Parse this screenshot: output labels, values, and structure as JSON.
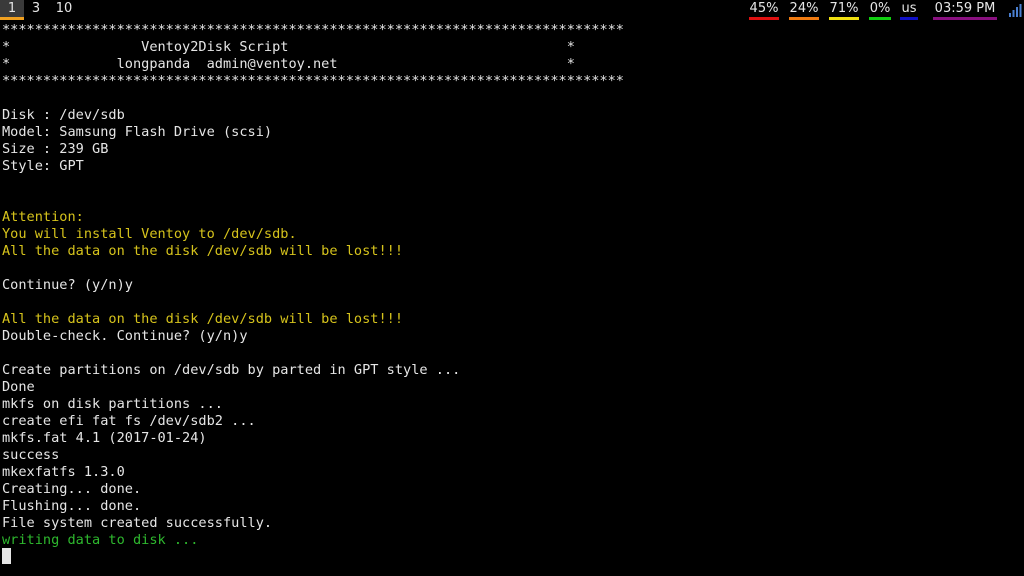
{
  "topbar": {
    "workspaces": [
      {
        "label": "1",
        "active": true
      },
      {
        "label": "3",
        "active": false
      },
      {
        "label": "10",
        "active": false
      }
    ],
    "stats": [
      {
        "label": "45%",
        "color": "#e01010"
      },
      {
        "label": "24%",
        "color": "#f07a10"
      },
      {
        "label": "71%",
        "color": "#f0e010"
      },
      {
        "label": "0%",
        "color": "#10d010"
      },
      {
        "label": "us",
        "color": "#1010c8"
      },
      {
        "label": "03:59 PM",
        "color": "#8a1080"
      }
    ],
    "signal_icon": "signal-bars-icon"
  },
  "terminal": {
    "lines": [
      {
        "text": "****************************************************************************",
        "color": "default"
      },
      {
        "text": "*                Ventoy2Disk Script                                  *",
        "color": "default"
      },
      {
        "text": "*             longpanda  admin@ventoy.net                            *",
        "color": "default"
      },
      {
        "text": "****************************************************************************",
        "color": "default"
      },
      {
        "text": "",
        "color": "default"
      },
      {
        "text": "Disk : /dev/sdb",
        "color": "default"
      },
      {
        "text": "Model: Samsung Flash Drive (scsi)",
        "color": "default"
      },
      {
        "text": "Size : 239 GB",
        "color": "default"
      },
      {
        "text": "Style: GPT",
        "color": "default"
      },
      {
        "text": "",
        "color": "default"
      },
      {
        "text": "",
        "color": "default"
      },
      {
        "text": "Attention:",
        "color": "yellow"
      },
      {
        "text": "You will install Ventoy to /dev/sdb.",
        "color": "yellow"
      },
      {
        "text": "All the data on the disk /dev/sdb will be lost!!!",
        "color": "yellow"
      },
      {
        "text": "",
        "color": "default"
      },
      {
        "text": "Continue? (y/n)y",
        "color": "default"
      },
      {
        "text": "",
        "color": "default"
      },
      {
        "text": "All the data on the disk /dev/sdb will be lost!!!",
        "color": "yellow"
      },
      {
        "text": "Double-check. Continue? (y/n)y",
        "color": "default"
      },
      {
        "text": "",
        "color": "default"
      },
      {
        "text": "Create partitions on /dev/sdb by parted in GPT style ...",
        "color": "default"
      },
      {
        "text": "Done",
        "color": "default"
      },
      {
        "text": "mkfs on disk partitions ...",
        "color": "default"
      },
      {
        "text": "create efi fat fs /dev/sdb2 ...",
        "color": "default"
      },
      {
        "text": "mkfs.fat 4.1 (2017-01-24)",
        "color": "default"
      },
      {
        "text": "success",
        "color": "default"
      },
      {
        "text": "mkexfatfs 1.3.0",
        "color": "default"
      },
      {
        "text": "Creating... done.",
        "color": "default"
      },
      {
        "text": "Flushing... done.",
        "color": "default"
      },
      {
        "text": "File system created successfully.",
        "color": "default"
      },
      {
        "text": "writing data to disk ...",
        "color": "green"
      }
    ]
  }
}
